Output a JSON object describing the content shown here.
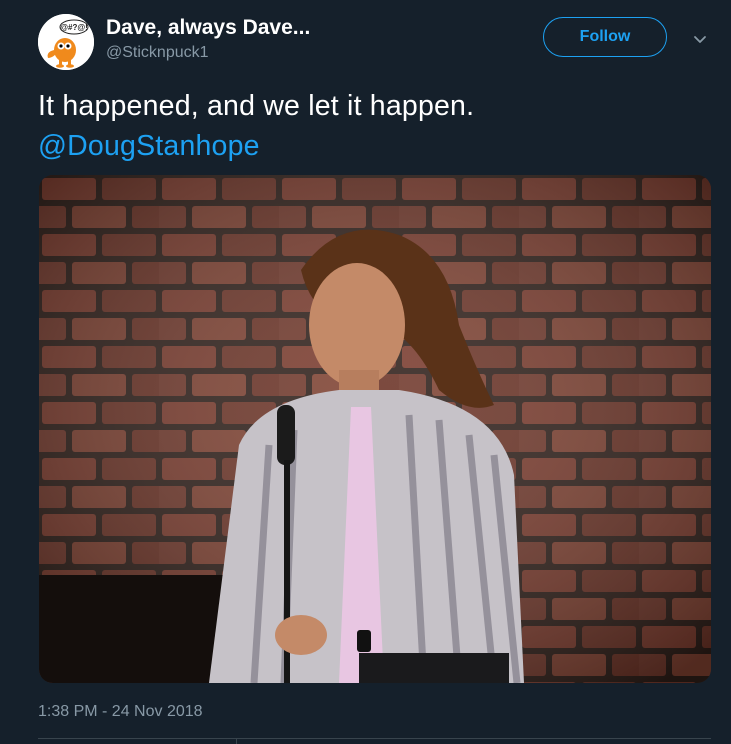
{
  "tweet": {
    "author": {
      "display_name": "Dave, always Dave...",
      "handle": "@Sticknpuck1",
      "avatar_text": "@#?@!"
    },
    "follow_label": "Follow",
    "text": "It happened, and we let it happen.",
    "mention": "@DougStanhope",
    "timestamp": "1:38 PM - 24 Nov 2018"
  },
  "colors": {
    "background": "#15202b",
    "accent": "#1da1f2",
    "secondary_text": "#8899a6"
  },
  "icons": {
    "caret": "chevron-down-icon"
  }
}
